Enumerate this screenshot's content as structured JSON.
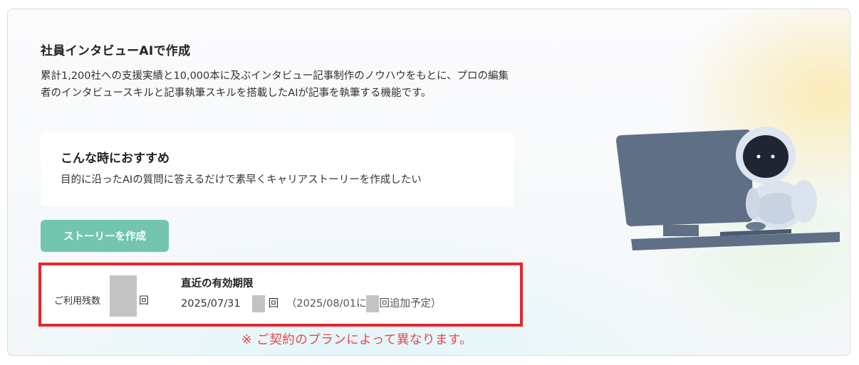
{
  "section": {
    "title": "社員インタビューAIで作成",
    "description": "累計1,200社への支援実績と10,000本に及ぶインタビュー記事制作のノウハウをもとに、プロの編集者のインタビュースキルと記事執筆スキルを搭載したAIが記事を執筆する機能です。"
  },
  "recommendation": {
    "title": "こんな時におすすめ",
    "text": "目的に沿ったAIの質問に答えるだけで素早くキャリアストーリーを作成したい"
  },
  "create_button_label": "ストーリーを作成",
  "usage": {
    "remaining_label": "ご利用残数",
    "remaining_unit": "回",
    "expiry_title": "直近の有効期限",
    "expiry_date": "2025/07/31",
    "expiry_unit": "回",
    "addition_prefix": "（2025/08/01に",
    "addition_suffix": "回追加予定）"
  },
  "plan_note": "※ ご契約のプランによって異なります。",
  "colors": {
    "accent_button": "#73c5ad",
    "highlight_border": "#e8252d",
    "note_text": "#e8474c"
  },
  "icons": {
    "illustration": "robot-at-computer-illustration"
  }
}
